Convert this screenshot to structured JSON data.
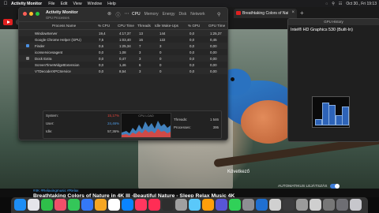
{
  "menubar": {
    "app": "Activity Monitor",
    "items": [
      "File",
      "Edit",
      "View",
      "Window",
      "Help"
    ],
    "clock": "Oct 30., Fri  19:13"
  },
  "browser": {
    "tab_title": "Breathtaking Colors of Nature",
    "video_caption": "Következő",
    "autoplay_label": "AUTOMATIKUS LEJÁTSZÁS",
    "tags": "#4K #Relaxingmusic #Relax",
    "video_title": "Breathtaking Colors of Nature in 4K III -Beautiful Nature - Sleep Relax Music 4K"
  },
  "activity_monitor": {
    "title": "Activity Monitor",
    "subtitle": "GPU Processes",
    "tabs": [
      "CPU",
      "Memory",
      "Energy",
      "Disk",
      "Network"
    ],
    "active_tab": "CPU",
    "columns": [
      "Process Name",
      "% CPU",
      "CPU Time",
      "Threads",
      "Idle Wake-Ups",
      "% GPU",
      "GPU Time"
    ],
    "rows": [
      {
        "name": "WindowServer",
        "cpu": "19,4",
        "time": "4:17,37",
        "threads": "13",
        "idle": "144",
        "gpu": "0,0",
        "gtime": "1:25,37"
      },
      {
        "name": "Google Chrome Helper (GPU)",
        "cpu": "7,5",
        "time": "1:03,40",
        "threads": "16",
        "idle": "122",
        "gpu": "0,0",
        "gtime": "0,45"
      },
      {
        "name": "Finder",
        "cpu": "0,6",
        "time": "1:25,34",
        "threads": "7",
        "idle": "3",
        "gpu": "0,0",
        "gtime": "0,00"
      },
      {
        "name": "iconservicesagent",
        "cpu": "0,0",
        "time": "1,08",
        "threads": "3",
        "idle": "0",
        "gpu": "0,0",
        "gtime": "0,00"
      },
      {
        "name": "Dock Extra",
        "cpu": "0,0",
        "time": "0,47",
        "threads": "3",
        "idle": "0",
        "gpu": "0,0",
        "gtime": "0,00"
      },
      {
        "name": "ScreenTimeWidgetExtension",
        "cpu": "0,0",
        "time": "1,46",
        "threads": "6",
        "idle": "0",
        "gpu": "0,0",
        "gtime": "0,00"
      },
      {
        "name": "VTDecoderXPCService",
        "cpu": "0,0",
        "time": "8,54",
        "threads": "3",
        "idle": "0",
        "gpu": "0,0",
        "gtime": "0,00"
      }
    ],
    "stats": {
      "system_label": "System:",
      "system_value": "15,17%",
      "user_label": "User:",
      "user_value": "24,46%",
      "idle_label": "Idle:",
      "idle_value": "57,36%",
      "cpu_load_label": "CPU LOAD",
      "threads_label": "Threads:",
      "threads_value": "1 546",
      "processes_label": "Processes:",
      "processes_value": "395"
    },
    "colors": {
      "system": "#e0443a",
      "user": "#4f9de8"
    }
  },
  "gpu_history": {
    "title": "GPU History",
    "gpu_name": "Intel® HD Graphics 530 (Built-In)",
    "bar_levels": [
      0.2,
      0.85,
      0.75,
      0.35,
      0.7
    ]
  }
}
